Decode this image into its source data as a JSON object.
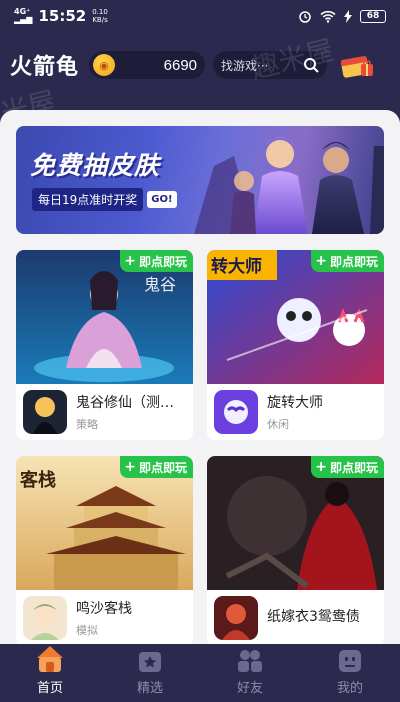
{
  "status_bar": {
    "network": "4G⁺",
    "time": "15:52",
    "speed_value": "0.10",
    "speed_unit": "KB/s",
    "battery": "68"
  },
  "header": {
    "app_title": "火箭龟",
    "coins": "6690",
    "search_placeholder": "找游戏···"
  },
  "banner": {
    "title": "免费抽皮肤",
    "subtitle": "每日19点准时开奖",
    "go_label": "GO!"
  },
  "badge_label": "即点即玩",
  "games": [
    {
      "name": "鬼谷修仙（测…",
      "tag": "策略"
    },
    {
      "name": "旋转大师",
      "tag": "休闲"
    },
    {
      "name": "鸣沙客栈",
      "tag": "模拟"
    },
    {
      "name": "纸嫁衣3鸳鸯债",
      "tag": ""
    }
  ],
  "nav": {
    "items": [
      {
        "label": "首页",
        "icon": "home-icon",
        "active": true
      },
      {
        "label": "精选",
        "icon": "featured-icon",
        "active": false
      },
      {
        "label": "好友",
        "icon": "friends-icon",
        "active": false
      },
      {
        "label": "我的",
        "icon": "profile-icon",
        "active": false
      }
    ]
  },
  "colors": {
    "header_bg": "#2b2a4e",
    "badge_green": "#27c24a",
    "coin_gold": "#f3a11b"
  }
}
